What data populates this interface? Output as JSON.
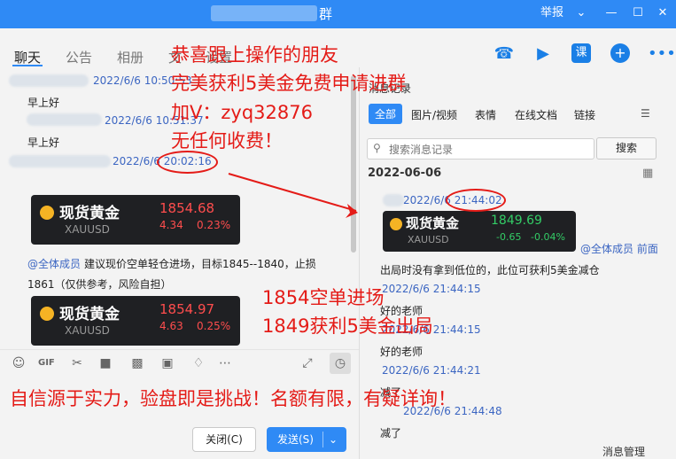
{
  "window": {
    "title_suffix": "群",
    "report_label": "举报",
    "chevron_icon": "chevron-down-icon",
    "minimize_icon": "minimize-icon",
    "maximize_icon": "maximize-icon",
    "close_icon": "close-icon"
  },
  "tabs": [
    {
      "label": "聊天"
    },
    {
      "label": "公告"
    },
    {
      "label": "相册"
    },
    {
      "label": "文"
    },
    {
      "label": "设置"
    }
  ],
  "header_icons": [
    "phone-icon",
    "video-icon",
    "course-icon",
    "add-icon",
    "more-icon"
  ],
  "chat": {
    "messages": [
      {
        "time": "2022/6/6 10:50:53",
        "text": "早上好"
      },
      {
        "time": "2022/6/6 10:51:37",
        "text": "早上好"
      },
      {
        "time": "2022/6/6 20:02:16",
        "text": ""
      }
    ],
    "card1": {
      "name": "现货黄金",
      "code": "XAUUSD",
      "price": "1854.68",
      "change": "4.34",
      "percent": "0.23%"
    },
    "notice": {
      "mention": "@全体成员",
      "text1": " 建议现价空单轻仓进场，目标1845--1840，止损",
      "text2": "1861（仅供参考，风险自担）"
    },
    "card2": {
      "name": "现货黄金",
      "code": "XAUUSD",
      "price": "1854.97",
      "change": "4.63",
      "percent": "0.25%"
    }
  },
  "toolbar_icons": [
    "emoji-icon",
    "gif-icon",
    "scissors-icon",
    "folder-icon",
    "cloud-doc-icon",
    "image-icon",
    "bell-icon",
    "more-icon",
    "expand-icon",
    "history-icon"
  ],
  "input": {
    "close_label": "关闭(C)",
    "send_label": "发送(S)",
    "send_dropdown_icon": "chevron-down-icon"
  },
  "history": {
    "title": "消息记录",
    "tabs": [
      "全部",
      "图片/视频",
      "表情",
      "在线文档",
      "链接"
    ],
    "filter_icon": "filter-icon",
    "search_placeholder": "搜索消息记录",
    "search_button": "搜索",
    "date_header": "2022-06-06",
    "calendar_icon": "calendar-icon",
    "card": {
      "name": "现货黄金",
      "code": "XAUUSD",
      "price": "1849.69",
      "change": "-0.65",
      "percent": "-0.04%"
    },
    "entries": [
      {
        "time": "2022/6/6 21:44:02",
        "text": ""
      },
      {
        "time": "2022/6/6 21:44:15",
        "text": "好的老师"
      },
      {
        "time": "2022/6/6 21:44:15",
        "text": "好的老师"
      },
      {
        "time": "2022/6/6 21:44:21",
        "text": "减了"
      },
      {
        "time": "2022/6/6 21:44:48",
        "text": "减了"
      }
    ],
    "mention_tail": "@全体成员 前面",
    "mention_line2": "出局时没有拿到低位的，此位可获利5美金减仓",
    "manage_label": "消息管理"
  },
  "overlay": {
    "lines": [
      "恭喜跟上操作的朋友",
      "完美获利5美金免费申请进群",
      "加V：zyq32876",
      "无任何收费！"
    ],
    "mid_lines": [
      "1854空单进场",
      "1849获利5美金出局"
    ],
    "bottom": "自信源于实力，验盘即是挑战！名额有限，有疑详询！",
    "color": "#e41b17"
  }
}
